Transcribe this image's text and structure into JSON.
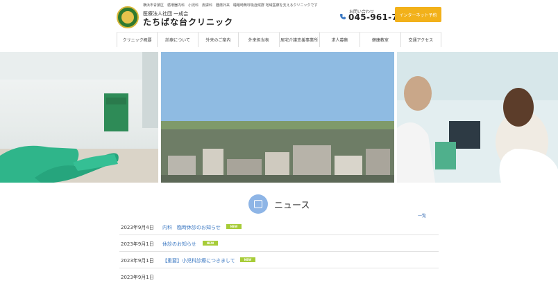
{
  "header": {
    "tagline": "横浜市青葉区　循環器内科　小児科　皮膚科　腫瘍外来　睡眠時無呼吸症候群 地域医療を支えるクリニックです",
    "corp_name": "医療法人社団 一成会",
    "clinic_name": "たちばな台クリニック",
    "tel_label": "お問い合わせ",
    "tel_number": "045-961-7835",
    "web_reserve": "インターネット予約"
  },
  "nav": {
    "items": [
      "クリニック概要",
      "診療について",
      "外来のご案内",
      "外来担当表",
      "居宅介護支援事業所",
      "求人募集",
      "健康教室",
      "交通アクセス"
    ]
  },
  "news": {
    "title": "ニュース",
    "more_label": "一覧",
    "items": [
      {
        "date": "2023年9月4日",
        "text": "内科　臨時休診のお知らせ",
        "badge": "NEW"
      },
      {
        "date": "2023年9月1日",
        "text": "休診のお知らせ",
        "badge": "NEW"
      },
      {
        "date": "2023年9月1日",
        "text": "【重要】小児科診療につきまして",
        "badge": "NEW"
      },
      {
        "date": "2023年9月1日",
        "text": "",
        "badge": ""
      }
    ]
  },
  "colors": {
    "accent": "#f2b11a",
    "link": "#3b78c2",
    "badge": "#a7cc38"
  }
}
